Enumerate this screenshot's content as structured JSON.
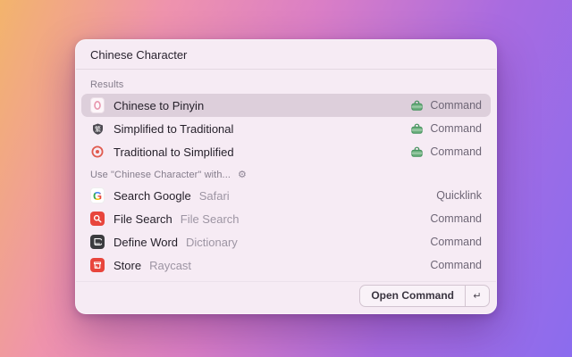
{
  "window": {
    "search": {
      "value": "Chinese Character"
    },
    "sections": [
      {
        "header": "Results",
        "has_gear": false,
        "items": [
          {
            "title": "Chinese to Pinyin",
            "subtitle": "",
            "accessory": "Command",
            "accessory_icon": "command-badge-icon",
            "icon": "pinyin-icon",
            "selected": true
          },
          {
            "title": "Simplified to Traditional",
            "subtitle": "",
            "accessory": "Command",
            "accessory_icon": "command-badge-icon",
            "icon": "traditional-icon",
            "selected": false
          },
          {
            "title": "Traditional to Simplified",
            "subtitle": "",
            "accessory": "Command",
            "accessory_icon": "command-badge-icon",
            "icon": "simplified-icon",
            "selected": false
          }
        ]
      },
      {
        "header": "Use \"Chinese Character\" with...",
        "has_gear": true,
        "gear_glyph": "⚙",
        "items": [
          {
            "title": "Search Google",
            "subtitle": "Safari",
            "accessory": "Quicklink",
            "accessory_icon": null,
            "icon": "google-g-icon",
            "selected": false
          },
          {
            "title": "File Search",
            "subtitle": "File Search",
            "accessory": "Command",
            "accessory_icon": null,
            "icon": "file-search-icon",
            "selected": false
          },
          {
            "title": "Define Word",
            "subtitle": "Dictionary",
            "accessory": "Command",
            "accessory_icon": null,
            "icon": "dictionary-icon",
            "selected": false
          },
          {
            "title": "Store",
            "subtitle": "Raycast",
            "accessory": "Command",
            "accessory_icon": null,
            "icon": "store-icon",
            "selected": false
          }
        ]
      }
    ],
    "footer": {
      "action_label": "Open Command",
      "key_hint": "↵"
    }
  },
  "colors": {
    "command_green": "#4f9d66",
    "selection_bg": "#ddcfdb",
    "window_bg": "#f6ebf4",
    "file_search_red": "#e8453c",
    "store_red": "#e8453c",
    "dictionary_dark": "#3b3b3f",
    "pinyin_pink": "#e795ad"
  }
}
